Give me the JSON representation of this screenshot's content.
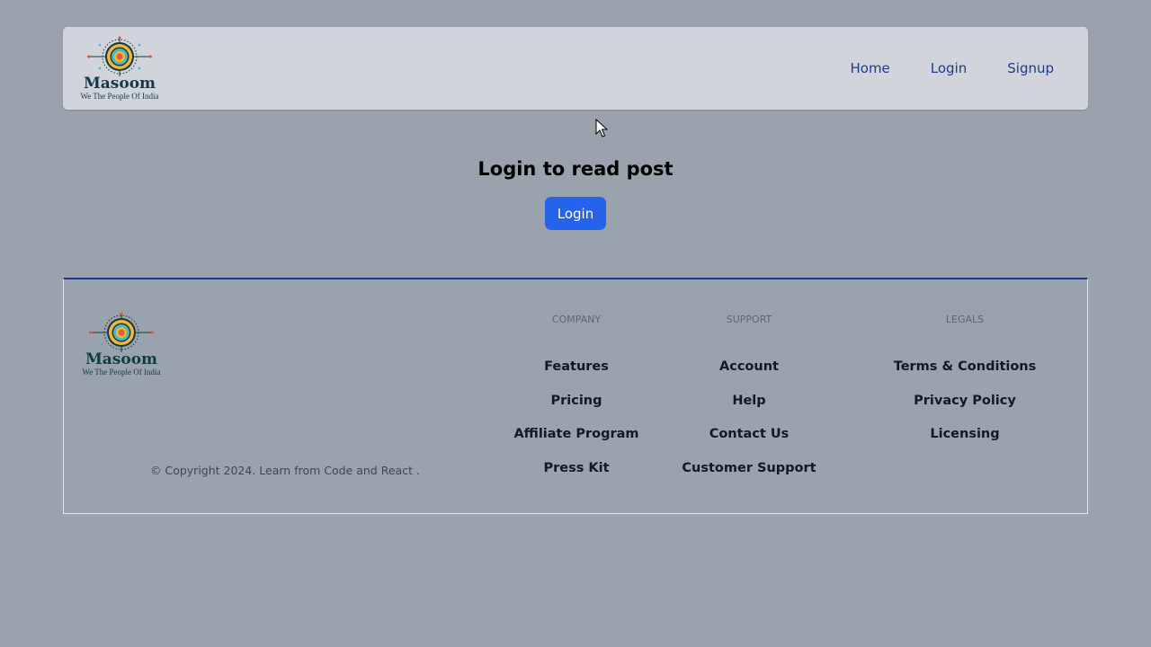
{
  "header": {
    "logo": {
      "name": "Masoom",
      "tagline": "We The People Of India"
    },
    "nav": [
      {
        "label": "Home"
      },
      {
        "label": "Login"
      },
      {
        "label": "Signup"
      }
    ]
  },
  "main": {
    "heading": "Login to read post",
    "login_button": "Login"
  },
  "footer": {
    "logo": {
      "name": "Masoom",
      "tagline": "We The People Of India"
    },
    "copyright": "© Copyright 2024. Learn from Code and React .",
    "columns": [
      {
        "title": "Company",
        "links": [
          "Features",
          "Pricing",
          "Affiliate Program",
          "Press Kit"
        ]
      },
      {
        "title": "Support",
        "links": [
          "Account",
          "Help",
          "Contact Us",
          "Customer Support"
        ]
      },
      {
        "title": "Legals",
        "links": [
          "Terms & Conditions",
          "Privacy Policy",
          "Licensing"
        ]
      }
    ]
  },
  "colors": {
    "page_background": "#9aa2ad",
    "header_background": "#d1d5db",
    "nav_link": "#1e3a8a",
    "primary_button": "#2563eb",
    "footer_accent": "#1e3a8a"
  },
  "icons": [
    "target-logo-icon",
    "mouse-cursor-icon"
  ]
}
